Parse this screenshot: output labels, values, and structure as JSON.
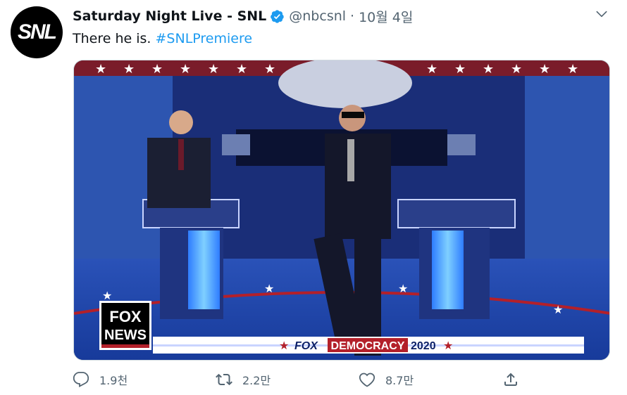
{
  "account": {
    "avatar_text": "SNL",
    "display_name": "Saturday Night Live - SNL",
    "handle": "@nbcsnl",
    "separator": "·",
    "date": "10월 4일",
    "verified": true
  },
  "tweet": {
    "text": "There he is.",
    "hashtag": "#SNLPremiere"
  },
  "media": {
    "description": "Debate stage scene",
    "lower_third": {
      "network_logo_line1": "FOX",
      "network_logo_line2": "NEWS",
      "brand": "FOX",
      "label": "DEMOCRACY",
      "year": "2020"
    }
  },
  "actions": {
    "reply_count": "1.9천",
    "retweet_count": "2.2만",
    "like_count": "8.7만"
  },
  "colors": {
    "accent": "#1d9bf0",
    "muted": "#536471",
    "stage_blue": "#1a3a8a",
    "stage_red": "#b3202a"
  }
}
